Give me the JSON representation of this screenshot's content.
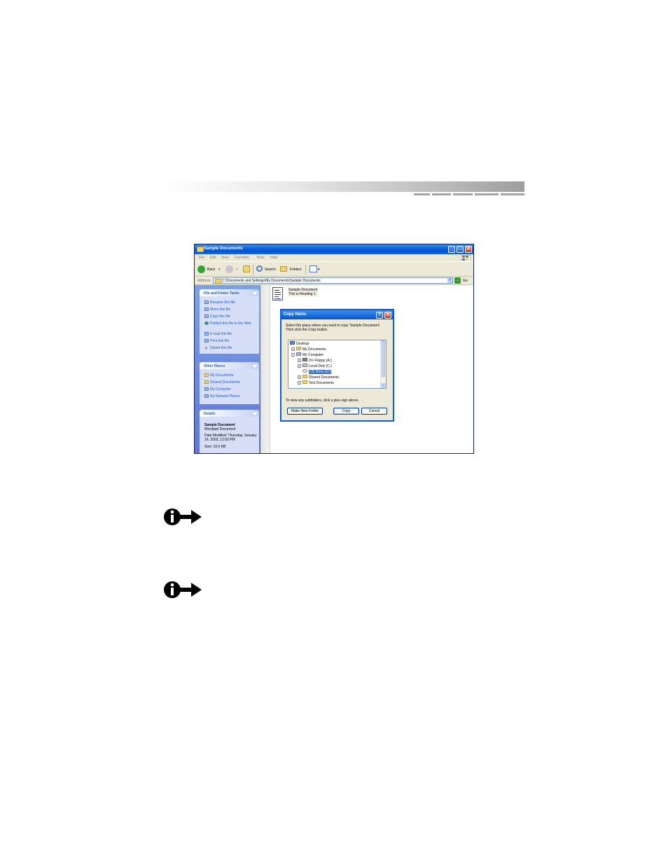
{
  "window": {
    "title": "Sample Documents",
    "menu": [
      "File",
      "Edit",
      "View",
      "Favorites",
      "Tools",
      "Help"
    ],
    "toolbar": {
      "back_label": "Back",
      "search_label": "Search",
      "folders_label": "Folders"
    },
    "address": {
      "label": "Address",
      "value": "C:\\Documents and Settings\\My Documents\\Sample Documents",
      "go_label": "Go"
    }
  },
  "left_pane": {
    "file_tasks": {
      "title": "File and Folder Tasks",
      "items": [
        "Rename this file",
        "Move this file",
        "Copy this file",
        "Publish this file to the Web",
        "E-mail this file",
        "Print this file",
        "Delete this file"
      ]
    },
    "other_places": {
      "title": "Other Places",
      "items": [
        "My Documents",
        "Shared Documents",
        "My Computer",
        "My Network Places"
      ]
    },
    "details": {
      "title": "Details",
      "name": "Sample Document",
      "type": "Wordpad Document",
      "modified": "Date Modified: Thursday, January 16, 2003, 12:02 PM",
      "size": "Size: 19.0 KB"
    }
  },
  "file": {
    "name": "Sample Document",
    "subtitle": "This is Heading 1"
  },
  "dialog": {
    "title": "Copy Items",
    "message": "Select the place where you want to copy 'Sample Document'. Then click the Copy button.",
    "tree": [
      {
        "label": "Desktop",
        "level": 0,
        "expander": ""
      },
      {
        "label": "My Documents",
        "level": 1,
        "expander": "+"
      },
      {
        "label": "My Computer",
        "level": 1,
        "expander": "-"
      },
      {
        "label": "3½ Floppy (A:)",
        "level": 2,
        "expander": "+"
      },
      {
        "label": "Local Disk (C:)",
        "level": 2,
        "expander": "+"
      },
      {
        "label": "CD Drive (D:)",
        "level": 2,
        "expander": "",
        "selected": true
      },
      {
        "label": "Shared Documents",
        "level": 2,
        "expander": "+"
      },
      {
        "label": "Test Documents",
        "level": 2,
        "expander": "+"
      }
    ],
    "hint": "To view any subfolders, click a plus sign above.",
    "buttons": {
      "new_folder": "Make New Folder",
      "copy": "Copy",
      "cancel": "Cancel"
    }
  },
  "colors": {
    "xp_blue": "#0a5ed8",
    "task_link": "#215dc6",
    "selection": "#316ac5"
  },
  "icons": [
    "info-arrow-icon",
    "folder-icon",
    "back-arrow-icon",
    "forward-arrow-icon",
    "up-folder-icon",
    "search-icon",
    "views-icon",
    "go-arrow-icon",
    "close-icon",
    "help-icon"
  ]
}
